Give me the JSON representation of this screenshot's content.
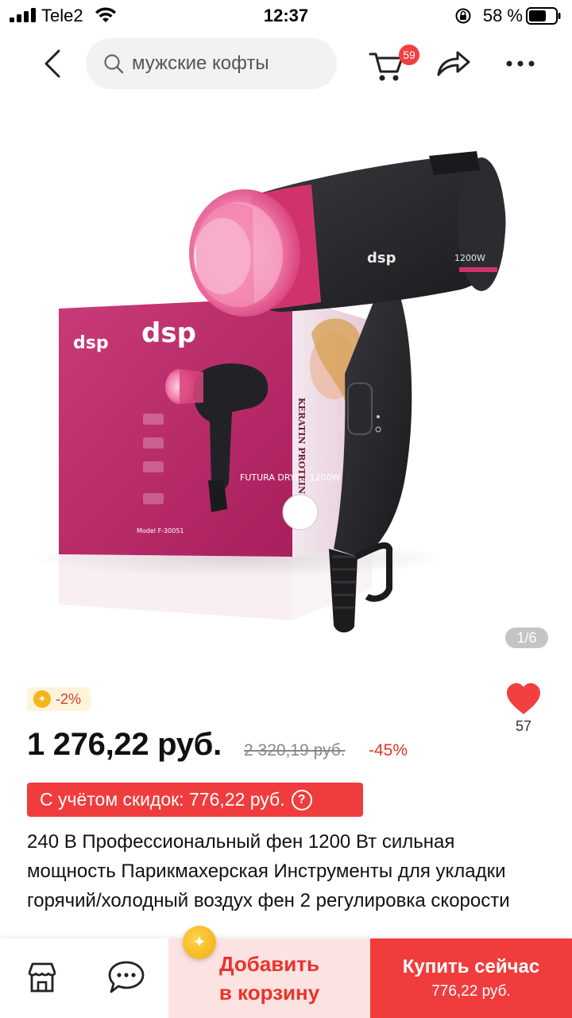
{
  "status_bar": {
    "carrier": "Tele2",
    "time": "12:37",
    "battery_percent": "58 %"
  },
  "header": {
    "search_placeholder": "мужские кофты",
    "cart_badge": "59"
  },
  "gallery": {
    "counter": "1/6"
  },
  "product": {
    "coin_discount": "-2%",
    "price": "1 276,22 руб.",
    "old_price": "2 320,19 руб.",
    "discount": "-45%",
    "favorites": "57",
    "promo_text": "С учётом скидок: 776,22 руб.",
    "promo_help": "?",
    "title": "240 В Профессиональный фен 1200 Вт сильная мощность Парикмахерская Инструменты для укладки горячий/холодный воздух фен 2 регулировка скорости"
  },
  "image_text": {
    "box_logo": "dsp",
    "box_logo_small": "dsp",
    "dryer_logo": "dsp",
    "power": "1200W",
    "box_model": "FUTURA DRYER 1200W",
    "box_side": "KERATIN PROTEIN",
    "box_model_no": "Model F-30051"
  },
  "bottom_bar": {
    "add_to_cart_line1": "Добавить",
    "add_to_cart_line2": "в корзину",
    "buy_now_label": "Купить сейчас",
    "buy_now_price": "776,22 руб."
  },
  "colors": {
    "accent_red": "#f03c3c",
    "price_red": "#e8342b",
    "add_cart_bg": "#fde2e2",
    "product_pink": "#d0336b"
  }
}
